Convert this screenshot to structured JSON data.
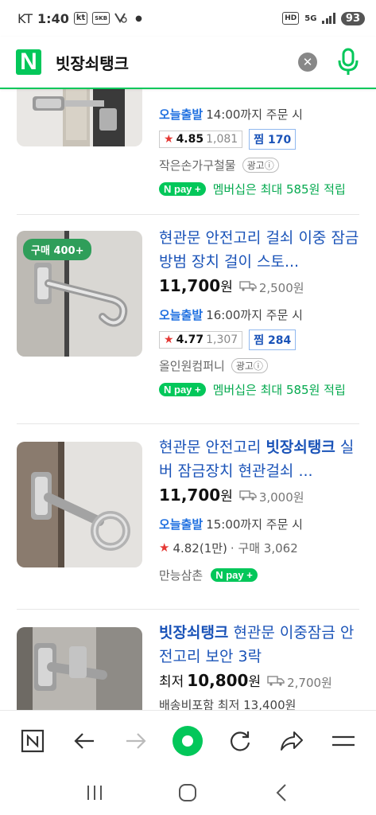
{
  "status": {
    "carrier": "KT",
    "time": "1:40",
    "icon_kt": "kt",
    "icon_box": "SKB",
    "net": "5G",
    "hd": "HD",
    "battery": "93"
  },
  "search": {
    "logo": "N",
    "query": "빗장쇠탱크"
  },
  "items": [
    {
      "title_pre": "",
      "title_hl": "",
      "title_post": "",
      "price": "",
      "shipping": "",
      "today_label": "오늘출발",
      "today_text": "14:00까지 주문 시",
      "rating": "4.85",
      "review_count": "1,081",
      "zzim": "찜 170",
      "seller": "작은손가구철물",
      "ad": "광고ⓘ",
      "npay": "N pay +",
      "member": "멤버십은 최대 585원 적립"
    },
    {
      "badge": "구매 400+",
      "title_pre": "현관문 안전고리 걸쇠 이중 잠금 방범 장치 걸이 스토...",
      "price": "11,700",
      "price_unit": "원",
      "shipping": "2,500원",
      "today_label": "오늘출발",
      "today_text": "16:00까지 주문 시",
      "rating": "4.77",
      "review_count": "1,307",
      "zzim": "찜 284",
      "seller": "올인원컴퍼니",
      "ad": "광고ⓘ",
      "npay": "N pay +",
      "member": "멤버십은 최대 585원 적립"
    },
    {
      "title_pre": "현관문 안전고리 ",
      "title_hl": "빗장쇠탱크",
      "title_post": " 실버 잠금장치 현관걸쇠 ...",
      "price": "11,700",
      "price_unit": "원",
      "shipping": "3,000원",
      "today_label": "오늘출발",
      "today_text": "15:00까지 주문 시",
      "rating_text": "4.82(1만)",
      "purchase": "· 구매 3,062",
      "seller": "만능삼촌",
      "npay": "N pay +"
    },
    {
      "title_hl": "빗장쇠탱크",
      "title_post": " 현관문 이중잠금 안전고리 보안 3락",
      "price_prefix": "최저",
      "price": "10,800",
      "price_unit": "원",
      "shipping": "2,700원",
      "cut_text": "배송비포함 최저 13,400원"
    }
  ],
  "colors": {
    "naver_green": "#03c75a",
    "link_blue": "#1a53b8",
    "today_blue": "#1e6fe0",
    "star_red": "#e53935"
  },
  "toolbar": {
    "icons": [
      "naver-home-icon",
      "back-icon",
      "forward-icon",
      "green-dot-icon",
      "refresh-icon",
      "share-icon",
      "menu-icon"
    ]
  },
  "navbar": {
    "icons": [
      "recent-apps-icon",
      "home-icon",
      "back-nav-icon"
    ]
  }
}
